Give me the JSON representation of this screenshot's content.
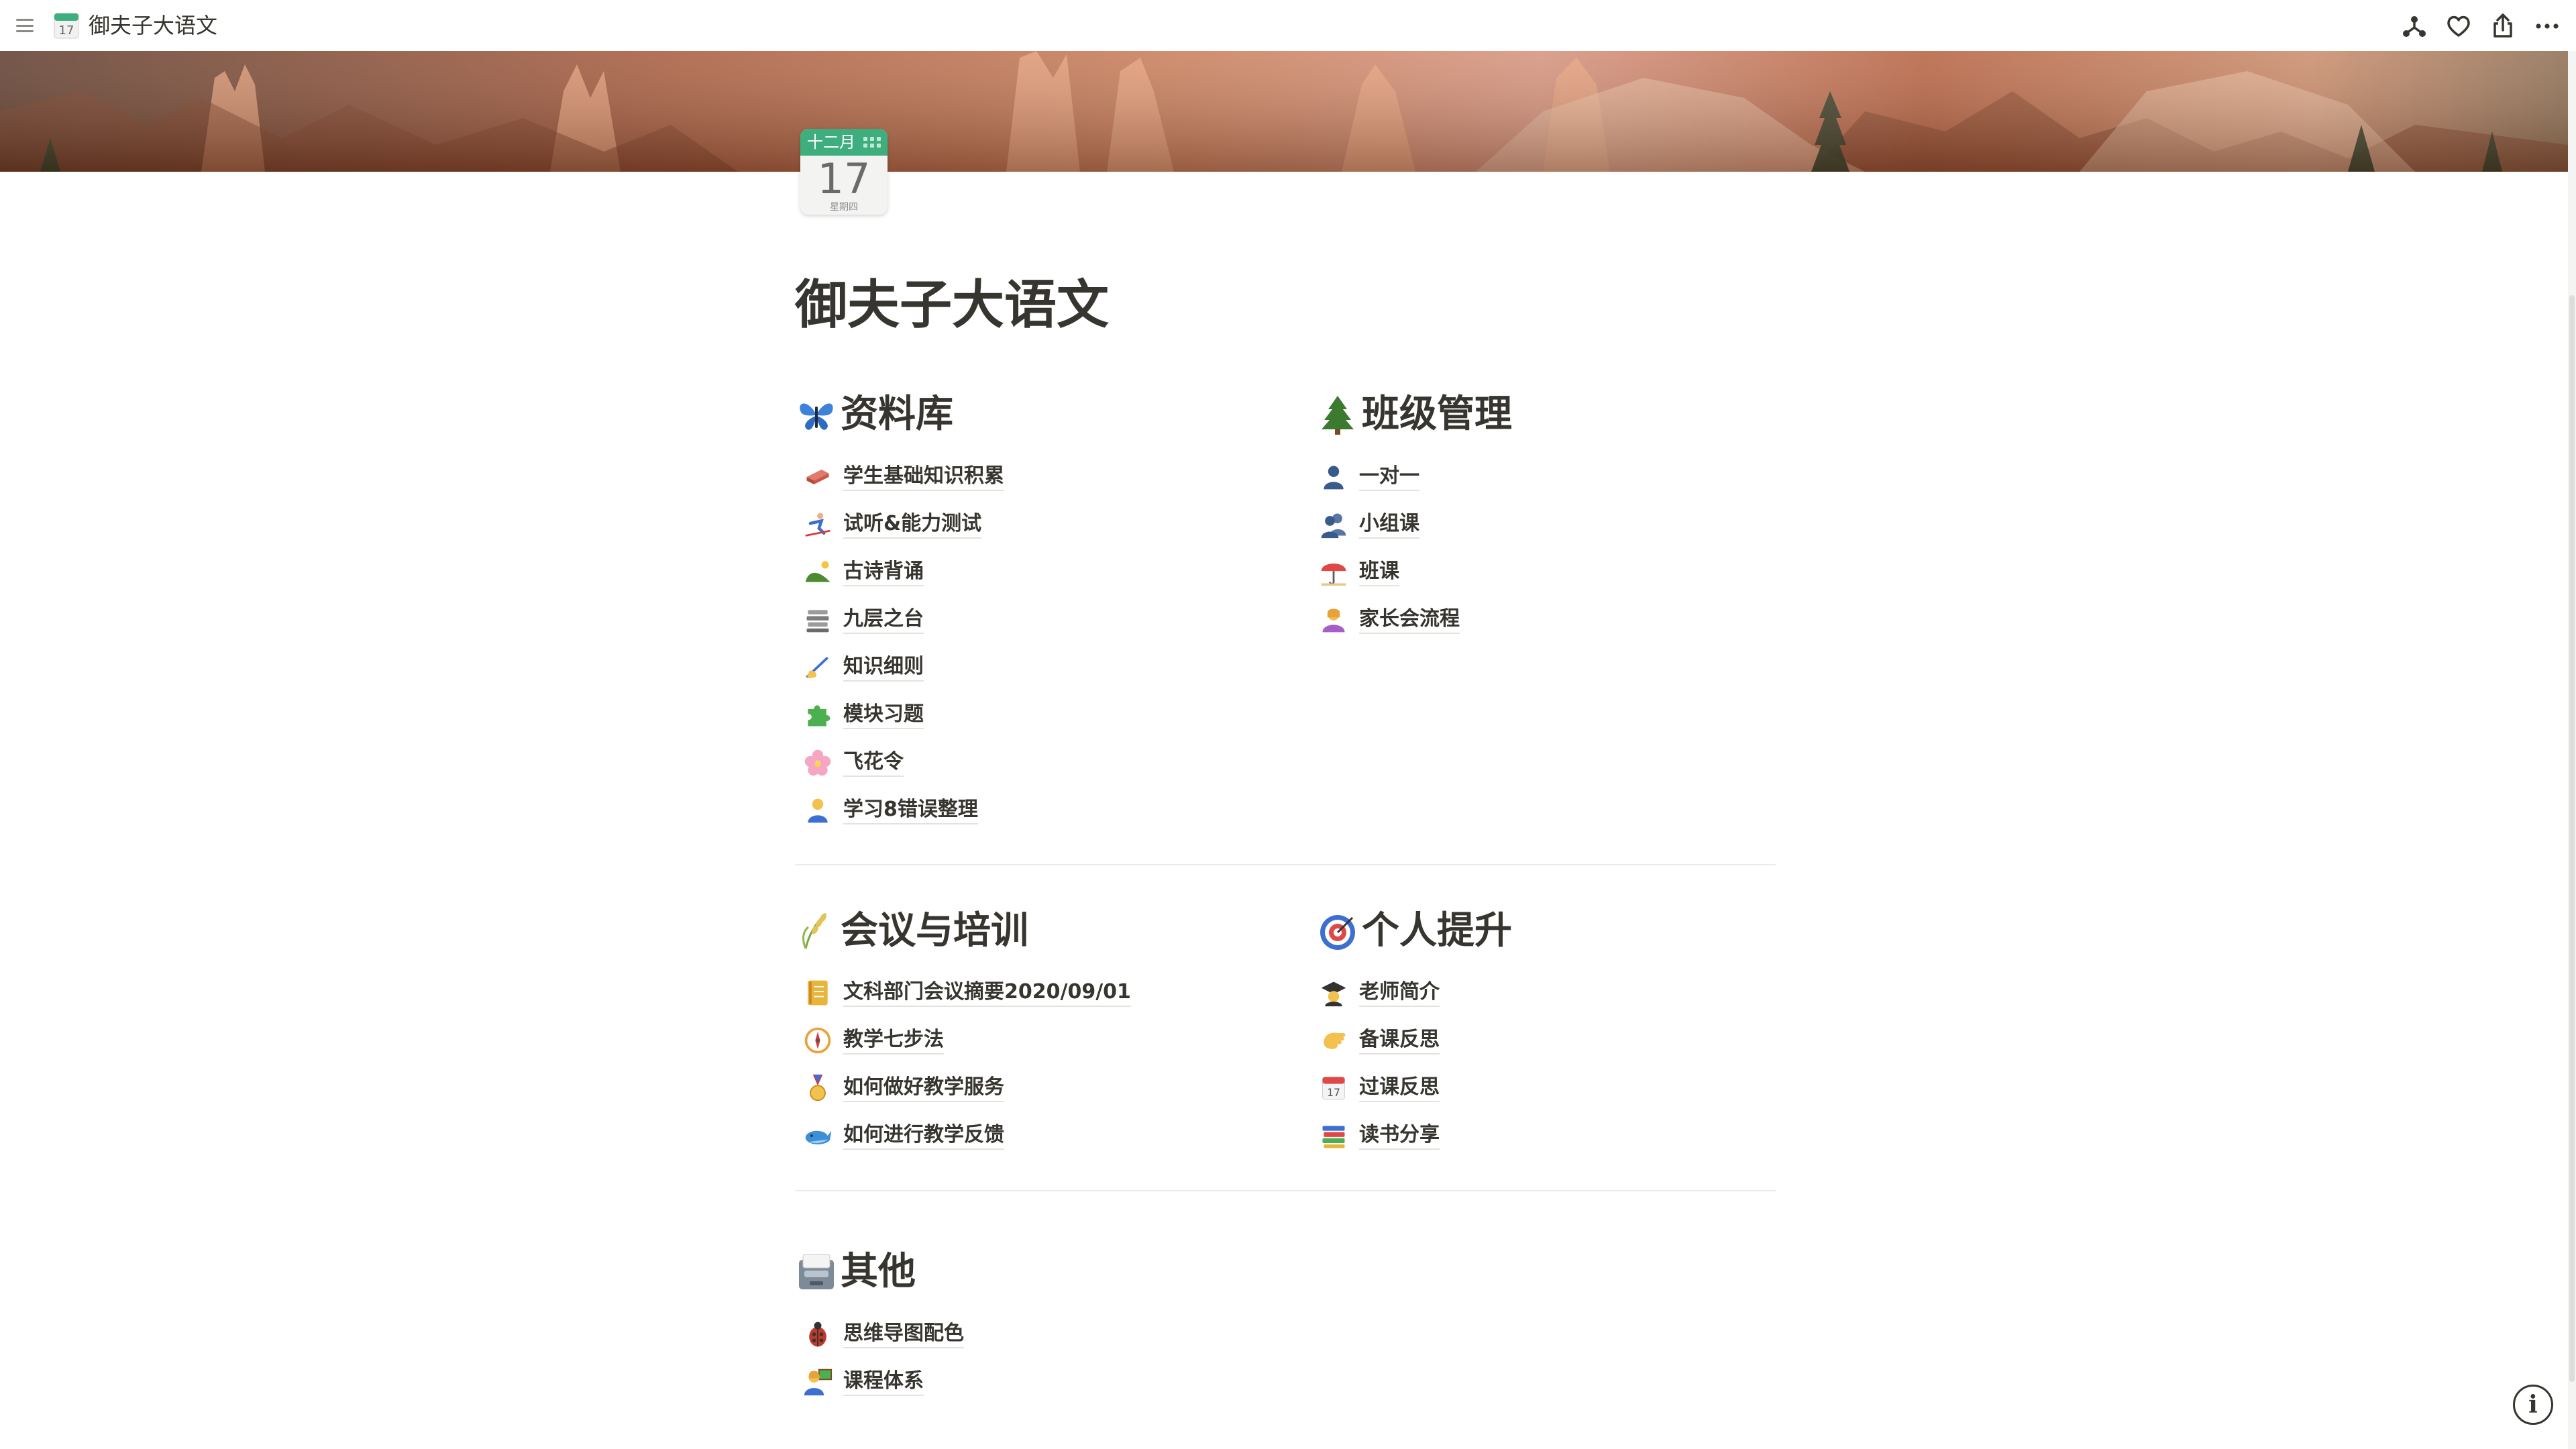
{
  "topbar": {
    "title": "御夫子大语文",
    "icons": [
      "menu-icon",
      "calendar-icon",
      "network-icon",
      "heart-icon",
      "share-icon",
      "more-icon"
    ]
  },
  "calendar_icon": {
    "month": "十二月",
    "day": "17",
    "weekday": "星期四"
  },
  "page": {
    "title": "御夫子大语文"
  },
  "sections": {
    "library": {
      "title": "资料库",
      "icon": "butterfly-icon",
      "items": [
        {
          "label": "学生基础知识积累",
          "icon": "brick-icon"
        },
        {
          "label": "试听&能力测试",
          "icon": "skier-icon"
        },
        {
          "label": "古诗背诵",
          "icon": "hill-icon"
        },
        {
          "label": "九层之台",
          "icon": "books-stack-icon"
        },
        {
          "label": "知识细则",
          "icon": "writing-hand-icon"
        },
        {
          "label": "模块习题",
          "icon": "puzzle-icon"
        },
        {
          "label": "飞花令",
          "icon": "blossom-icon"
        },
        {
          "label": "学习8错误整理",
          "icon": "person-icon"
        }
      ]
    },
    "class_mgmt": {
      "title": "班级管理",
      "icon": "tree-icon",
      "items": [
        {
          "label": "一对一",
          "icon": "user-icon"
        },
        {
          "label": "小组课",
          "icon": "users-icon"
        },
        {
          "label": "班课",
          "icon": "umbrella-icon"
        },
        {
          "label": "家长会流程",
          "icon": "person-shrug-icon"
        }
      ]
    },
    "meeting": {
      "title": "会议与培训",
      "icon": "rice-icon",
      "items": [
        {
          "label": "文科部门会议摘要2020/09/01",
          "icon": "notebook-icon"
        },
        {
          "label": "教学七步法",
          "icon": "compass-icon"
        },
        {
          "label": "如何做好教学服务",
          "icon": "medal-icon"
        },
        {
          "label": "如何进行教学反馈",
          "icon": "whale-icon"
        }
      ]
    },
    "personal": {
      "title": "个人提升",
      "icon": "target-icon",
      "items": [
        {
          "label": "老师简介",
          "icon": "graduation-cap-icon"
        },
        {
          "label": "备课反思",
          "icon": "hand-icon"
        },
        {
          "label": "过课反思",
          "icon": "calendar-icon"
        },
        {
          "label": "读书分享",
          "icon": "books-icon"
        }
      ]
    },
    "other": {
      "title": "其他",
      "icon": "card-box-icon",
      "items": [
        {
          "label": "思维导图配色",
          "icon": "beetle-icon"
        },
        {
          "label": "课程体系",
          "icon": "teacher-icon"
        }
      ]
    }
  },
  "info_button": {
    "label": "i"
  }
}
